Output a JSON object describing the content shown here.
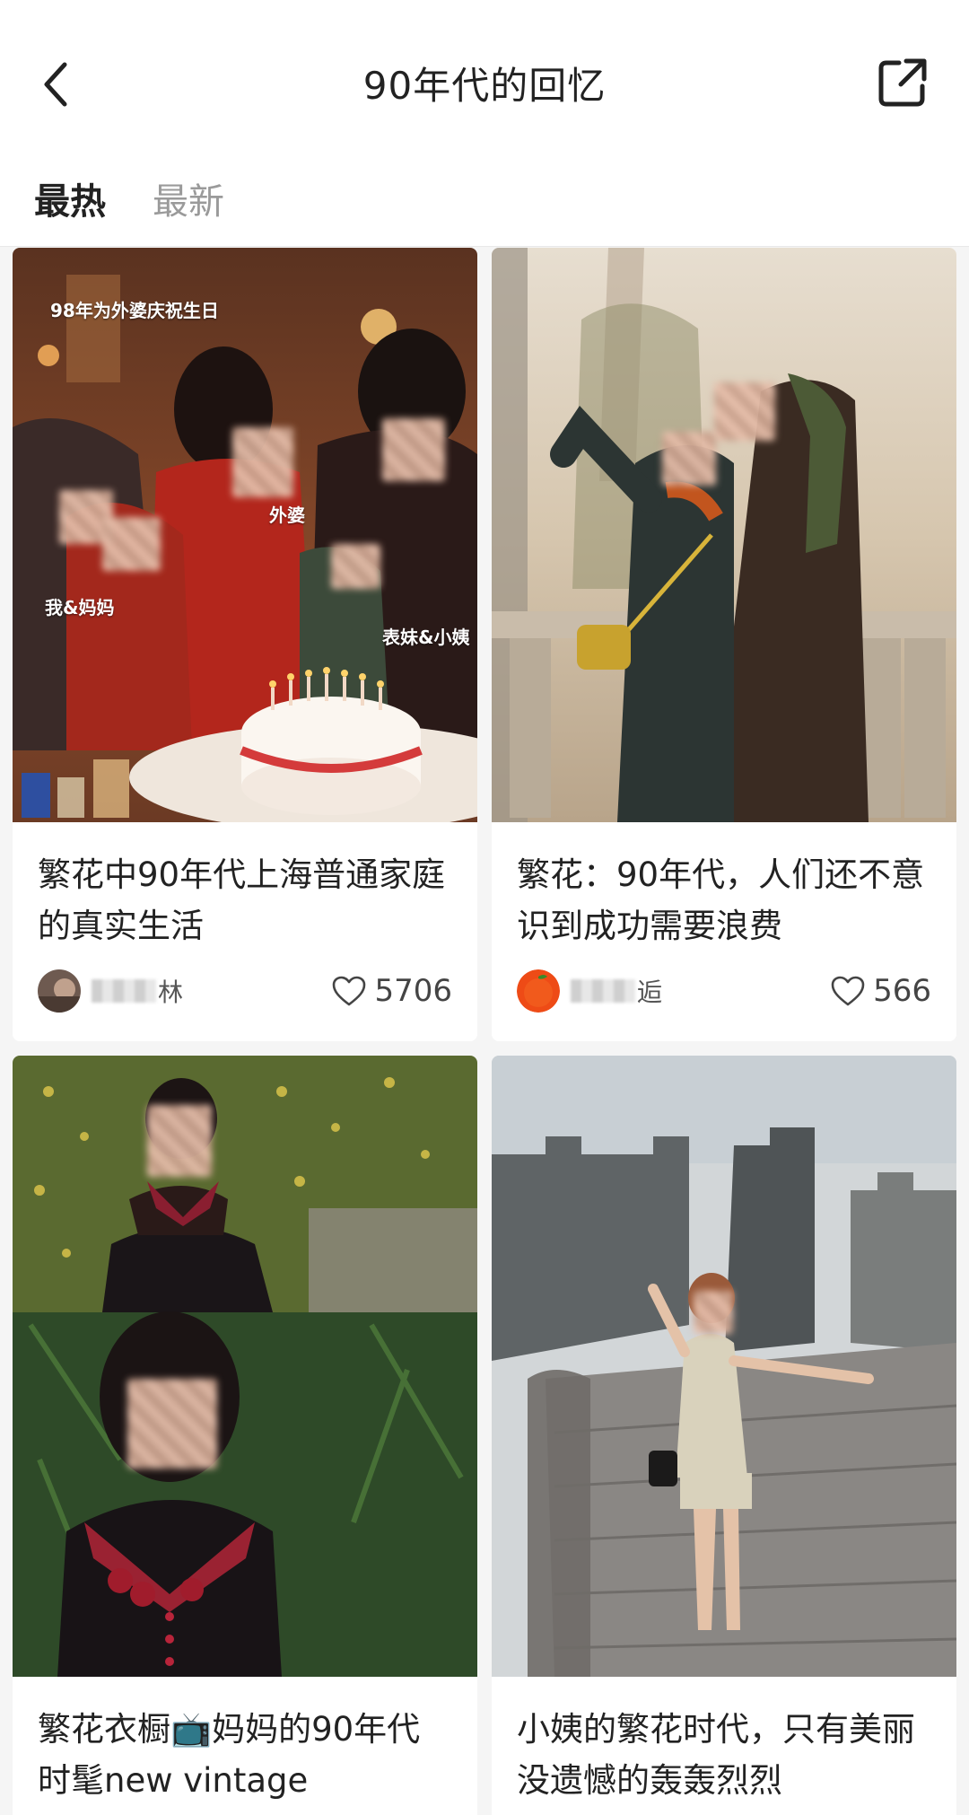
{
  "header": {
    "title": "90年代的回忆",
    "back_icon": "back-chevron-icon",
    "share_icon": "share-icon"
  },
  "tabs": [
    {
      "label": "最热",
      "active": true
    },
    {
      "label": "最新",
      "active": false
    }
  ],
  "cards": [
    {
      "title": "繁花中90年代上海普通家庭的真实生活",
      "author": "林",
      "likes": "5706",
      "photo_labels": [
        "98年为外婆庆祝生日",
        "外婆",
        "我&妈妈",
        "表妹&小姨"
      ]
    },
    {
      "title": "繁花：90年代，人们还不意识到成功需要浪费",
      "author": "逅",
      "likes": "566"
    },
    {
      "title": "繁花衣橱📺妈妈的90年代时髦new vintage"
    },
    {
      "title": "小姨的繁花时代，只有美丽没遗憾的轰轰烈烈"
    }
  ],
  "colors": {
    "background": "#f5f5f5",
    "card": "#ffffff",
    "active_tab": "#222222",
    "inactive_tab": "#9a9a9a"
  }
}
